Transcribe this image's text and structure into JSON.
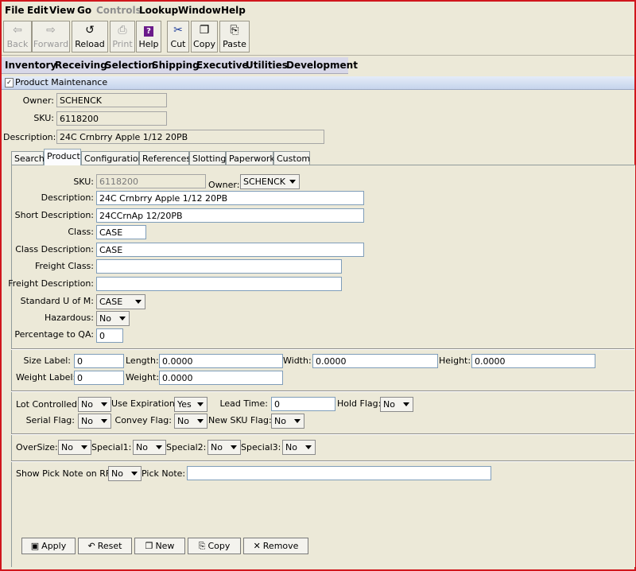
{
  "menu": [
    "File",
    "Edit",
    "View",
    "Go",
    "Controls",
    "Lookup",
    "Window",
    "Help"
  ],
  "toolbar": {
    "back": "Back",
    "forward": "Forward",
    "reload": "Reload",
    "print": "Print",
    "help": "Help",
    "cut": "Cut",
    "copy": "Copy",
    "paste": "Paste"
  },
  "modules": [
    "Inventory",
    "Receiving",
    "Selection",
    "Shipping",
    "Executive",
    "Utilities",
    "Development"
  ],
  "panel": {
    "title": "Product Maintenance"
  },
  "header": {
    "owner_label": "Owner:",
    "owner": "SCHENCK",
    "sku_label": "SKU:",
    "sku": "6118200",
    "desc_label": "Description:",
    "desc": "24C Crnbrry Apple 1/12 20PB"
  },
  "tabs": [
    "Search",
    "Product",
    "Configuration",
    "References",
    "Slotting",
    "Paperwork",
    "Custom"
  ],
  "product": {
    "sku_label": "SKU:",
    "sku": "6118200",
    "owner_label": "Owner:",
    "owner": "SCHENCK",
    "description_label": "Description:",
    "description": "24C Crnbrry Apple 1/12 20PB",
    "short_description_label": "Short Description:",
    "short_description": "24CCrnAp 12/20PB",
    "class_label": "Class:",
    "class": "CASE",
    "class_description_label": "Class Description:",
    "class_description": "CASE",
    "freight_class_label": "Freight Class:",
    "freight_class": "",
    "freight_description_label": "Freight Description:",
    "freight_description": "",
    "standard_uom_label": "Standard U of M:",
    "standard_uom": "CASE",
    "hazardous_label": "Hazardous:",
    "hazardous": "No",
    "percentage_qa_label": "Percentage to QA:",
    "percentage_qa": "0"
  },
  "size": {
    "size_label_label": "Size Label:",
    "size_label": "0",
    "length_label": "Length:",
    "length": "0.0000",
    "width_label": "Width:",
    "width": "0.0000",
    "height_label": "Height:",
    "height": "0.0000",
    "weight_label_label": "Weight Label:",
    "weight_label": "0",
    "weight_label2": "Weight:",
    "weight": "0.0000"
  },
  "flags": {
    "lot_controlled_label": "Lot Controlled:",
    "lot_controlled": "No",
    "use_expiration_label": "Use Expiration:",
    "use_expiration": "Yes",
    "lead_time_label": "Lead Time:",
    "lead_time": "0",
    "hold_flag_label": "Hold Flag:",
    "hold_flag": "No",
    "serial_flag_label": "Serial Flag:",
    "serial_flag": "No",
    "convey_flag_label": "Convey Flag:",
    "convey_flag": "No",
    "new_sku_flag_label": "New SKU Flag:",
    "new_sku_flag": "No"
  },
  "special": {
    "oversize_label": "OverSize:",
    "oversize": "No",
    "special1_label": "Special1:",
    "special1": "No",
    "special2_label": "Special2:",
    "special2": "No",
    "special3_label": "Special3:",
    "special3": "No"
  },
  "picknote": {
    "show_label": "Show Pick Note on RF:",
    "show": "No",
    "note_label": "Pick Note:",
    "note": ""
  },
  "buttons": {
    "apply": "Apply",
    "reset": "Reset",
    "new": "New",
    "copy": "Copy",
    "remove": "Remove"
  }
}
